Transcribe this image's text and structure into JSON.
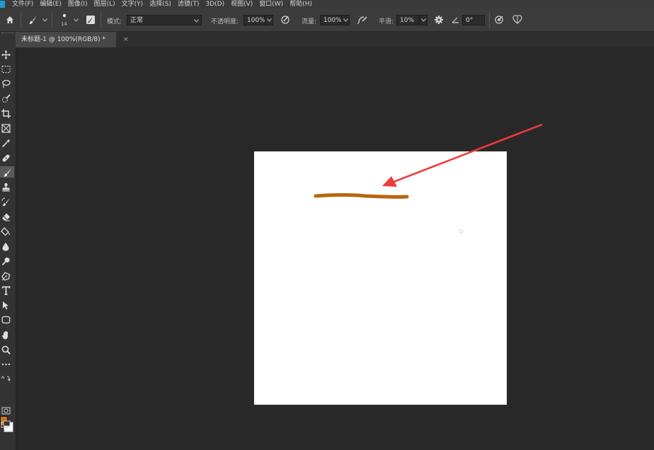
{
  "menu": {
    "items": [
      "文件(F)",
      "编辑(E)",
      "图像(I)",
      "图层(L)",
      "文字(Y)",
      "选择(S)",
      "滤镜(T)",
      "3D(D)",
      "视图(V)",
      "窗口(W)",
      "帮助(H)"
    ]
  },
  "options": {
    "brush_size": "14",
    "mode_label": "模式:",
    "mode_value": "正常",
    "opacity_label": "不透明度:",
    "opacity_value": "100%",
    "flow_label": "流量:",
    "flow_value": "100%",
    "smoothing_label": "平滑:",
    "smoothing_value": "10%",
    "angle_value": "0°"
  },
  "document": {
    "tab_title": "未标题-1 @ 100%(RGB/8) *",
    "close": "×"
  },
  "colors": {
    "foreground": "#c87413",
    "background": "#ffffff",
    "stroke": "#b8660f",
    "arrow": "#ee3b3b"
  },
  "tools": [
    "move-icon",
    "marquee-icon",
    "lasso-icon",
    "quick-select-icon",
    "crop-icon",
    "frame-icon",
    "eyedropper-icon",
    "healing-icon",
    "brush-icon",
    "stamp-icon",
    "history-brush-icon",
    "eraser-icon",
    "paint-bucket-icon",
    "blur-icon",
    "dodge-icon",
    "pen-icon",
    "type-icon",
    "path-select-icon",
    "shape-icon",
    "hand-icon",
    "zoom-icon",
    "more-icon"
  ]
}
